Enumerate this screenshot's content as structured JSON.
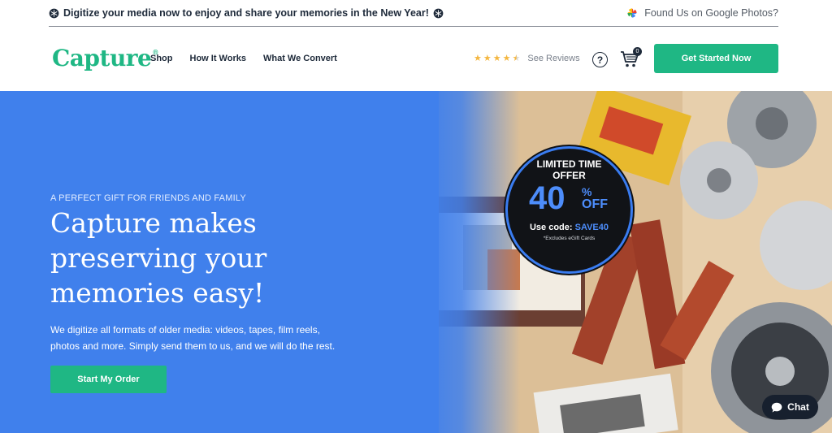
{
  "announcement": {
    "text": "Digitize your media now to enjoy and share your memories in the New Year!",
    "google_photos_text": "Found Us on Google Photos?"
  },
  "nav": {
    "logo": "Capture",
    "logo_reg": "®",
    "links": [
      "Shop",
      "How It Works",
      "What We Convert"
    ],
    "rating_stars": 4.5,
    "reviews_link": "See Reviews",
    "help_symbol": "?",
    "cart_count": "0",
    "cta": "Get Started Now"
  },
  "hero": {
    "eyebrow": "A PERFECT GIFT FOR FRIENDS AND FAMILY",
    "headline": "Capture makes preserving your memories easy!",
    "body": "We digitize all formats of older media: videos, tapes, film reels, photos and more. Simply send them to us, and we will do the rest.",
    "cta": "Start My Order"
  },
  "promo_badge": {
    "line1": "LIMITED TIME",
    "line2": "OFFER",
    "number": "40",
    "percent": "%",
    "off": "OFF",
    "code_label": "Use code:",
    "code": "SAVE40",
    "note": "*Excludes eGift Cards"
  },
  "chat": {
    "label": "Chat"
  },
  "colors": {
    "brand_green": "#1fb784",
    "hero_blue": "#4080ec",
    "badge_blue": "#4d8dfb",
    "dark_navy": "#1e2a3a",
    "star_gold": "#f4b63f"
  }
}
